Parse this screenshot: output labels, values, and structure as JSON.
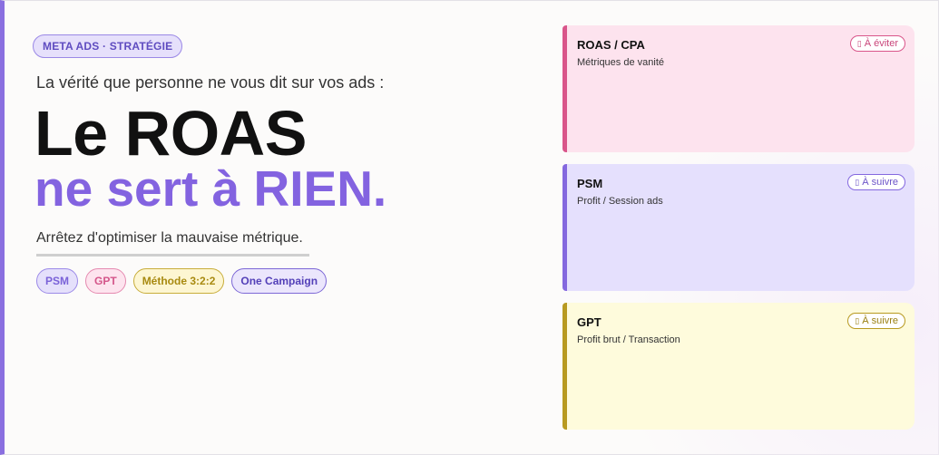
{
  "header": {
    "badge": "META ADS · STRATÉGIE",
    "kicker": "La vérité que personne ne vous dit sur vos ads :",
    "title_line1": "Le ROAS",
    "title_line2": "ne sert à RIEN.",
    "subtitle": "Arrêtez d'optimiser la mauvaise métrique."
  },
  "tags": [
    "PSM",
    "GPT",
    "Méthode 3:2:2",
    "One Campaign"
  ],
  "cards": [
    {
      "title": "ROAS / CPA",
      "desc": "Métriques de vanité",
      "status": "À éviter",
      "icon": "missing-glyph-icon",
      "color": "#d9558a"
    },
    {
      "title": "PSM",
      "desc": "Profit / Session ads",
      "status": "À suivre",
      "icon": "missing-glyph-icon",
      "color": "#8468df"
    },
    {
      "title": "GPT",
      "desc": "Profit brut / Transaction",
      "status": "À suivre",
      "icon": "missing-glyph-icon",
      "color": "#b89a20"
    }
  ],
  "accent": "#8363e0"
}
